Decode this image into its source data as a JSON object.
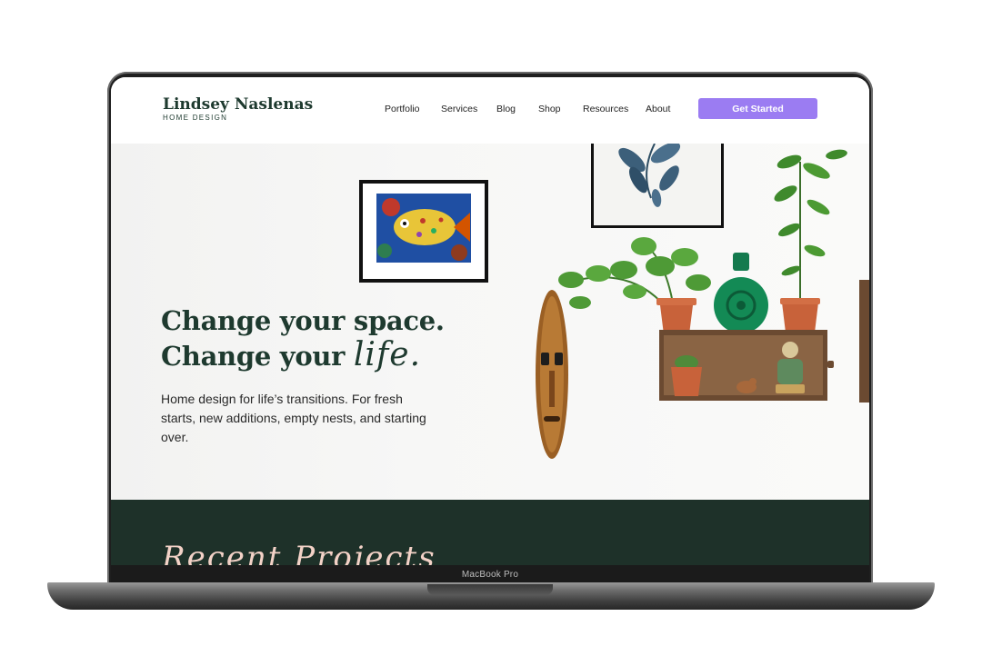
{
  "device": {
    "label": "MacBook Pro"
  },
  "brand": {
    "name": "Lindsey Naslenas",
    "tagline": "HOME DESIGN",
    "primary_color": "#1e3a2f",
    "accent_color": "#9b7cf2"
  },
  "nav": {
    "items": [
      "Portfolio",
      "Services",
      "Blog",
      "Shop",
      "Resources",
      "About"
    ],
    "cta_label": "Get Started"
  },
  "hero": {
    "title_line1": "Change your space.",
    "title_line2_prefix": "Change your",
    "title_line2_script": "life.",
    "subtitle": "Home design for life’s transitions. For fresh starts, new additions, empty nests, and starting over."
  },
  "projects": {
    "title": "Recent Projects"
  },
  "icons": [
    "fish-painting-icon",
    "leaf-print-icon",
    "tribal-mask-icon",
    "pothos-plant-icon",
    "green-vase-icon",
    "tall-plant-icon",
    "wooden-shelf-icon",
    "cactus-icon",
    "figurine-icon"
  ]
}
